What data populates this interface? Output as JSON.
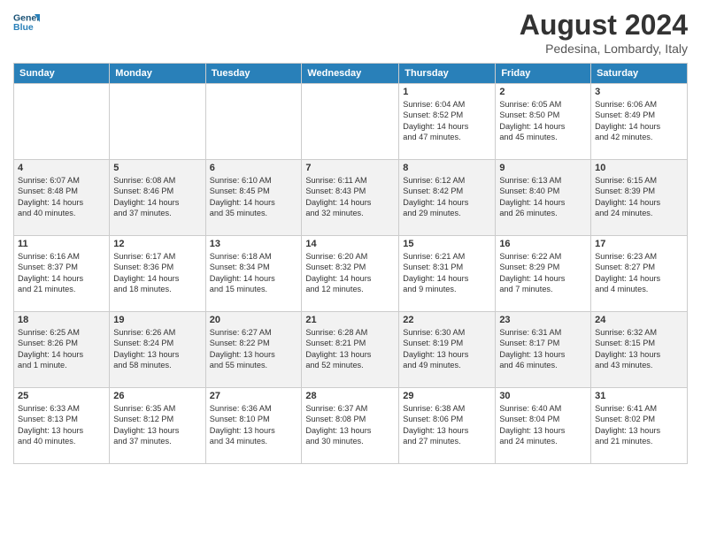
{
  "header": {
    "logo_line1": "General",
    "logo_line2": "Blue",
    "main_title": "August 2024",
    "subtitle": "Pedesina, Lombardy, Italy"
  },
  "calendar": {
    "days_of_week": [
      "Sunday",
      "Monday",
      "Tuesday",
      "Wednesday",
      "Thursday",
      "Friday",
      "Saturday"
    ],
    "weeks": [
      [
        {
          "day": "",
          "info": ""
        },
        {
          "day": "",
          "info": ""
        },
        {
          "day": "",
          "info": ""
        },
        {
          "day": "",
          "info": ""
        },
        {
          "day": "1",
          "info": "Sunrise: 6:04 AM\nSunset: 8:52 PM\nDaylight: 14 hours\nand 47 minutes."
        },
        {
          "day": "2",
          "info": "Sunrise: 6:05 AM\nSunset: 8:50 PM\nDaylight: 14 hours\nand 45 minutes."
        },
        {
          "day": "3",
          "info": "Sunrise: 6:06 AM\nSunset: 8:49 PM\nDaylight: 14 hours\nand 42 minutes."
        }
      ],
      [
        {
          "day": "4",
          "info": "Sunrise: 6:07 AM\nSunset: 8:48 PM\nDaylight: 14 hours\nand 40 minutes."
        },
        {
          "day": "5",
          "info": "Sunrise: 6:08 AM\nSunset: 8:46 PM\nDaylight: 14 hours\nand 37 minutes."
        },
        {
          "day": "6",
          "info": "Sunrise: 6:10 AM\nSunset: 8:45 PM\nDaylight: 14 hours\nand 35 minutes."
        },
        {
          "day": "7",
          "info": "Sunrise: 6:11 AM\nSunset: 8:43 PM\nDaylight: 14 hours\nand 32 minutes."
        },
        {
          "day": "8",
          "info": "Sunrise: 6:12 AM\nSunset: 8:42 PM\nDaylight: 14 hours\nand 29 minutes."
        },
        {
          "day": "9",
          "info": "Sunrise: 6:13 AM\nSunset: 8:40 PM\nDaylight: 14 hours\nand 26 minutes."
        },
        {
          "day": "10",
          "info": "Sunrise: 6:15 AM\nSunset: 8:39 PM\nDaylight: 14 hours\nand 24 minutes."
        }
      ],
      [
        {
          "day": "11",
          "info": "Sunrise: 6:16 AM\nSunset: 8:37 PM\nDaylight: 14 hours\nand 21 minutes."
        },
        {
          "day": "12",
          "info": "Sunrise: 6:17 AM\nSunset: 8:36 PM\nDaylight: 14 hours\nand 18 minutes."
        },
        {
          "day": "13",
          "info": "Sunrise: 6:18 AM\nSunset: 8:34 PM\nDaylight: 14 hours\nand 15 minutes."
        },
        {
          "day": "14",
          "info": "Sunrise: 6:20 AM\nSunset: 8:32 PM\nDaylight: 14 hours\nand 12 minutes."
        },
        {
          "day": "15",
          "info": "Sunrise: 6:21 AM\nSunset: 8:31 PM\nDaylight: 14 hours\nand 9 minutes."
        },
        {
          "day": "16",
          "info": "Sunrise: 6:22 AM\nSunset: 8:29 PM\nDaylight: 14 hours\nand 7 minutes."
        },
        {
          "day": "17",
          "info": "Sunrise: 6:23 AM\nSunset: 8:27 PM\nDaylight: 14 hours\nand 4 minutes."
        }
      ],
      [
        {
          "day": "18",
          "info": "Sunrise: 6:25 AM\nSunset: 8:26 PM\nDaylight: 14 hours\nand 1 minute."
        },
        {
          "day": "19",
          "info": "Sunrise: 6:26 AM\nSunset: 8:24 PM\nDaylight: 13 hours\nand 58 minutes."
        },
        {
          "day": "20",
          "info": "Sunrise: 6:27 AM\nSunset: 8:22 PM\nDaylight: 13 hours\nand 55 minutes."
        },
        {
          "day": "21",
          "info": "Sunrise: 6:28 AM\nSunset: 8:21 PM\nDaylight: 13 hours\nand 52 minutes."
        },
        {
          "day": "22",
          "info": "Sunrise: 6:30 AM\nSunset: 8:19 PM\nDaylight: 13 hours\nand 49 minutes."
        },
        {
          "day": "23",
          "info": "Sunrise: 6:31 AM\nSunset: 8:17 PM\nDaylight: 13 hours\nand 46 minutes."
        },
        {
          "day": "24",
          "info": "Sunrise: 6:32 AM\nSunset: 8:15 PM\nDaylight: 13 hours\nand 43 minutes."
        }
      ],
      [
        {
          "day": "25",
          "info": "Sunrise: 6:33 AM\nSunset: 8:13 PM\nDaylight: 13 hours\nand 40 minutes."
        },
        {
          "day": "26",
          "info": "Sunrise: 6:35 AM\nSunset: 8:12 PM\nDaylight: 13 hours\nand 37 minutes."
        },
        {
          "day": "27",
          "info": "Sunrise: 6:36 AM\nSunset: 8:10 PM\nDaylight: 13 hours\nand 34 minutes."
        },
        {
          "day": "28",
          "info": "Sunrise: 6:37 AM\nSunset: 8:08 PM\nDaylight: 13 hours\nand 30 minutes."
        },
        {
          "day": "29",
          "info": "Sunrise: 6:38 AM\nSunset: 8:06 PM\nDaylight: 13 hours\nand 27 minutes."
        },
        {
          "day": "30",
          "info": "Sunrise: 6:40 AM\nSunset: 8:04 PM\nDaylight: 13 hours\nand 24 minutes."
        },
        {
          "day": "31",
          "info": "Sunrise: 6:41 AM\nSunset: 8:02 PM\nDaylight: 13 hours\nand 21 minutes."
        }
      ]
    ]
  }
}
